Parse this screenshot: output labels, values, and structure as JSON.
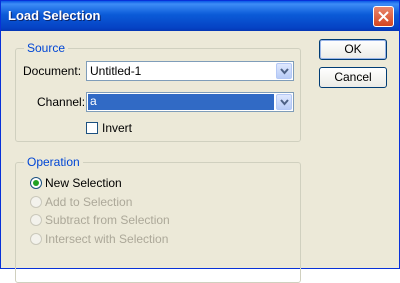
{
  "window": {
    "title": "Load Selection"
  },
  "source": {
    "legend": "Source",
    "document_label": "Document:",
    "document_value": "Untitled-1",
    "channel_label": "Channel:",
    "channel_value": "a",
    "invert_label": "Invert",
    "invert_checked": false
  },
  "operation": {
    "legend": "Operation",
    "options": [
      {
        "label": "New Selection",
        "selected": true,
        "enabled": true
      },
      {
        "label": "Add to Selection",
        "selected": false,
        "enabled": false
      },
      {
        "label": "Subtract from Selection",
        "selected": false,
        "enabled": false
      },
      {
        "label": "Intersect with Selection",
        "selected": false,
        "enabled": false
      }
    ]
  },
  "buttons": {
    "ok": "OK",
    "cancel": "Cancel"
  },
  "icons": {
    "close": "close-icon",
    "dropdown": "chevron-down-icon"
  },
  "colors": {
    "titlebar": "#0a5ae6",
    "legend": "#0046d5",
    "selection": "#316ac5",
    "radio_dot": "#21a121"
  }
}
